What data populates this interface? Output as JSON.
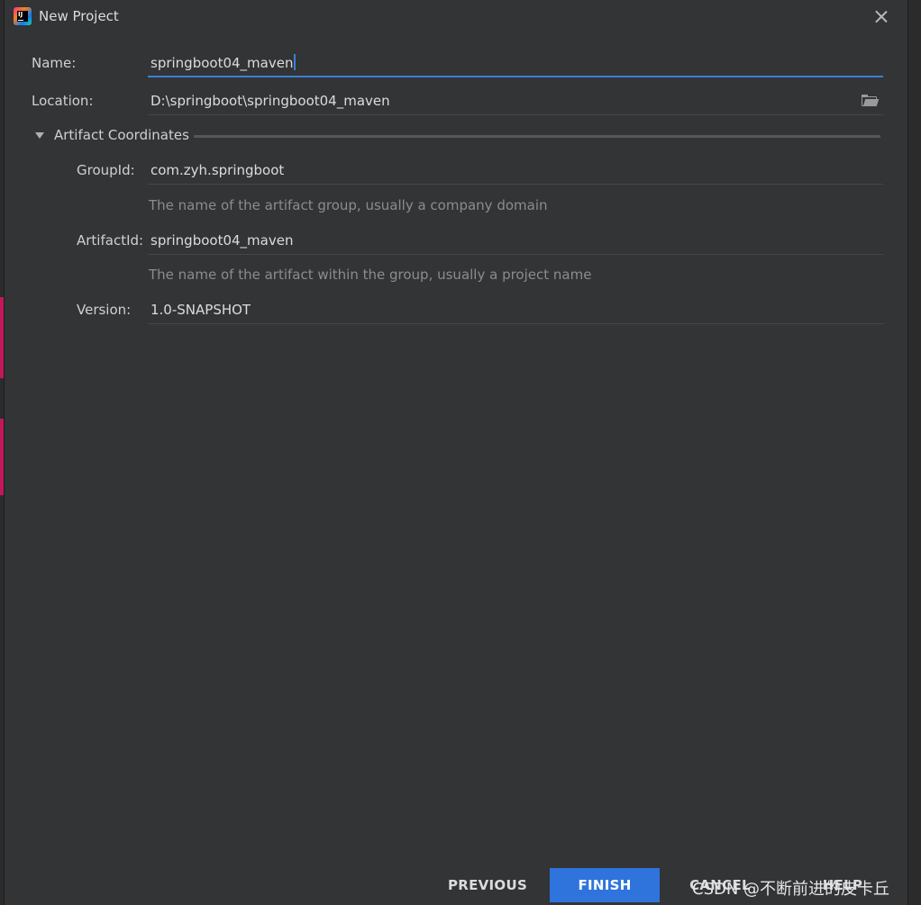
{
  "dialog": {
    "title": "New Project"
  },
  "form": {
    "name_label": "Name:",
    "name_value": "springboot04_maven",
    "location_label": "Location:",
    "location_value": "D:\\springboot\\springboot04_maven",
    "section_title": "Artifact Coordinates",
    "groupid_label": "GroupId:",
    "groupid_value": "com.zyh.springboot",
    "groupid_hint": "The name of the artifact group, usually a company domain",
    "artifactid_label": "ArtifactId:",
    "artifactid_value": "springboot04_maven",
    "artifactid_hint": "The name of the artifact within the group, usually a project name",
    "version_label": "Version:",
    "version_value": "1.0-SNAPSHOT"
  },
  "footer": {
    "previous_label": "PREVIOUS",
    "finish_label": "FINISH",
    "cancel_label": "CANCEL",
    "help_label": "HELP"
  },
  "watermark": "CSDN @不断前进的皮卡丘",
  "colors": {
    "accent": "#2f74dd",
    "focus_underline": "#3d7ed6",
    "dialog_bg": "#323436"
  },
  "icons": [
    "app-logo-icon",
    "close-icon",
    "folder-icon",
    "collapse-triangle-icon"
  ]
}
